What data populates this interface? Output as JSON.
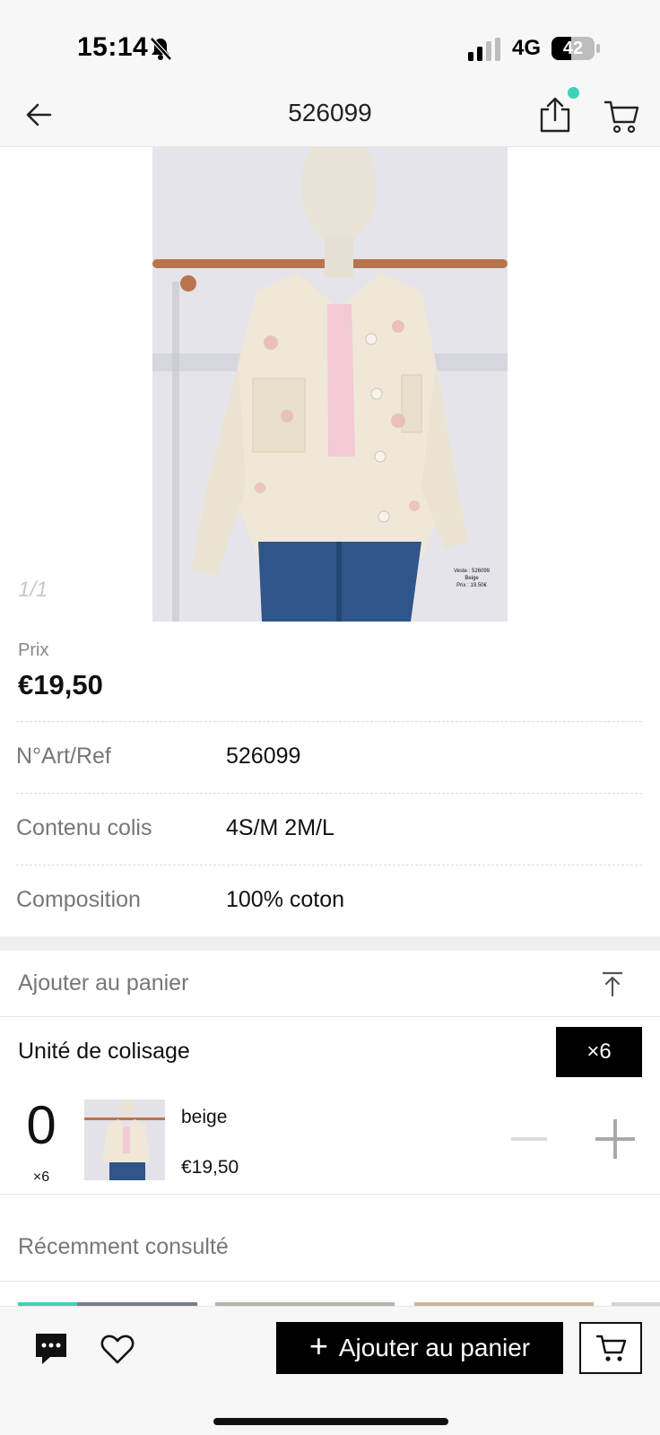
{
  "status_bar": {
    "time": "15:14",
    "network": "4G",
    "battery": "42"
  },
  "header": {
    "title": "526099"
  },
  "gallery": {
    "counter": "1/1",
    "tag_lines": [
      "Veste : 526099",
      "Beige",
      "Prix : 19.50€"
    ]
  },
  "price": {
    "label": "Prix",
    "value": "€19,50"
  },
  "specs": [
    {
      "label": "N°Art/Ref",
      "value": "526099"
    },
    {
      "label": "Contenu colis",
      "value": "4S/M 2M/L"
    },
    {
      "label": "Composition",
      "value": "100% coton"
    }
  ],
  "cart_panel": {
    "title": "Ajouter au panier",
    "unit_label": "Unité de colisage",
    "unit_badge": "×6",
    "variant": {
      "quantity": "0",
      "multiplier": "×6",
      "color": "beige",
      "price": "€19,50"
    }
  },
  "recent": {
    "title": "Récemment consulté"
  },
  "bottom_bar": {
    "add_to_cart": "Ajouter au panier"
  },
  "colors": {
    "accent_dot": "#3ed1b6",
    "primary": "#000000"
  },
  "icons": [
    "back-arrow-icon",
    "share-icon",
    "cart-icon",
    "bell-off-icon",
    "scroll-top-icon",
    "minus-icon",
    "plus-icon",
    "chat-icon",
    "heart-icon"
  ]
}
